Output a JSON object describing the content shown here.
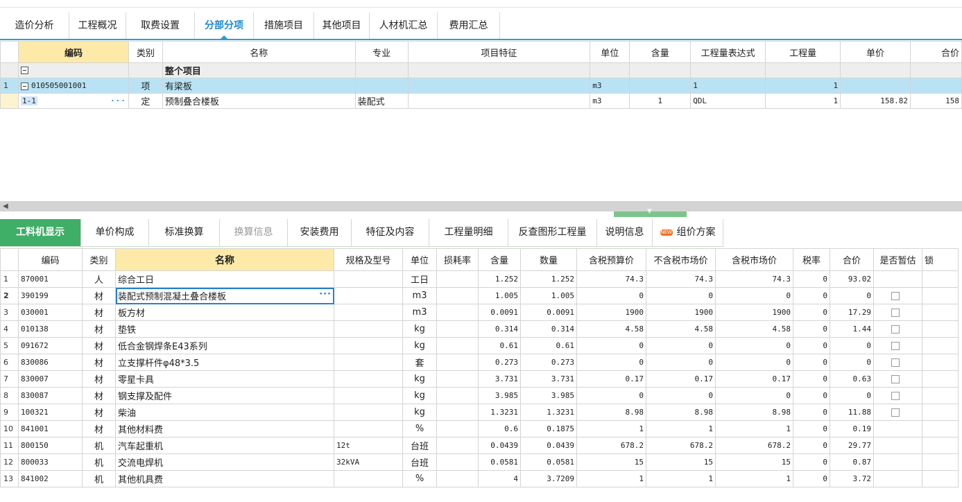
{
  "main_tabs": [
    {
      "label": "造价分析",
      "active": false
    },
    {
      "label": "工程概况",
      "active": false
    },
    {
      "label": "取费设置",
      "active": false
    },
    {
      "label": "分部分项",
      "active": true
    },
    {
      "label": "措施项目",
      "active": false
    },
    {
      "label": "其他项目",
      "active": false
    },
    {
      "label": "人材机汇总",
      "active": false
    },
    {
      "label": "费用汇总",
      "active": false
    }
  ],
  "top_table": {
    "headers": {
      "code": "编码",
      "type": "类别",
      "name": "名称",
      "spec": "专业",
      "feature": "项目特征",
      "unit": "单位",
      "qty_ratio": "含量",
      "expr": "工程量表达式",
      "quantity": "工程量",
      "price": "单价",
      "total": "合价"
    },
    "group_row": {
      "name": "整个项目"
    },
    "item_row": {
      "num": "1",
      "code": "010505001001",
      "type": "项",
      "name": "有梁板",
      "unit": "m3",
      "expr": "1",
      "quantity": "1"
    },
    "sub_row": {
      "code": "1-1",
      "ellipsis": "···",
      "type": "定",
      "name": "预制叠合楼板",
      "spec": "装配式",
      "unit": "m3",
      "qty_ratio": "1",
      "expr": "QDL",
      "quantity": "1",
      "price": "158.82",
      "total": "158"
    }
  },
  "lower_tabs": [
    {
      "label": "工料机显示",
      "state": "active"
    },
    {
      "label": "单价构成",
      "state": "normal"
    },
    {
      "label": "标准换算",
      "state": "normal"
    },
    {
      "label": "换算信息",
      "state": "disabled"
    },
    {
      "label": "安装费用",
      "state": "normal"
    },
    {
      "label": "特征及内容",
      "state": "normal"
    },
    {
      "label": "工程量明细",
      "state": "normal"
    },
    {
      "label": "反查图形工程量",
      "state": "normal"
    },
    {
      "label": "说明信息",
      "state": "normal"
    },
    {
      "label": "组价方案",
      "state": "normal",
      "badge": "NEW"
    }
  ],
  "bottom_table": {
    "headers": {
      "code": "编码",
      "type": "类别",
      "name": "名称",
      "spec": "规格及型号",
      "unit": "单位",
      "loss": "损耗率",
      "ratio": "含量",
      "qty": "数量",
      "tax_budget": "含税预算价",
      "notax_market": "不含税市场价",
      "tax_market": "含税市场价",
      "taxrate": "税率",
      "total": "合价",
      "provisional": "是否暂估",
      "lock": "锁"
    },
    "rows": [
      {
        "n": "1",
        "code": "870001",
        "type": "人",
        "name": "综合工日",
        "spec": "",
        "unit": "工日",
        "ratio": "1.252",
        "qty": "1.252",
        "tax_budget": "74.3",
        "notax_market": "74.3",
        "tax_market": "74.3",
        "taxrate": "0",
        "total": "93.02",
        "cb": false
      },
      {
        "n": "2",
        "code": "390199",
        "type": "材",
        "name": "装配式预制混凝土叠合楼板",
        "spec": "",
        "unit": "m3",
        "ratio": "1.005",
        "qty": "1.005",
        "tax_budget": "0",
        "notax_market": "0",
        "tax_market": "0",
        "taxrate": "0",
        "total": "0",
        "cb": true
      },
      {
        "n": "3",
        "code": "030001",
        "type": "材",
        "name": "板方材",
        "spec": "",
        "unit": "m3",
        "ratio": "0.0091",
        "qty": "0.0091",
        "tax_budget": "1900",
        "notax_market": "1900",
        "tax_market": "1900",
        "taxrate": "0",
        "total": "17.29",
        "cb": true
      },
      {
        "n": "4",
        "code": "010138",
        "type": "材",
        "name": "垫铁",
        "spec": "",
        "unit": "kg",
        "ratio": "0.314",
        "qty": "0.314",
        "tax_budget": "4.58",
        "notax_market": "4.58",
        "tax_market": "4.58",
        "taxrate": "0",
        "total": "1.44",
        "cb": true
      },
      {
        "n": "5",
        "code": "091672",
        "type": "材",
        "name": "低合金钢焊条E43系列",
        "spec": "",
        "unit": "kg",
        "ratio": "0.61",
        "qty": "0.61",
        "tax_budget": "0",
        "notax_market": "0",
        "tax_market": "0",
        "taxrate": "0",
        "total": "0",
        "cb": true
      },
      {
        "n": "6",
        "code": "830086",
        "type": "材",
        "name": "立支撑杆件φ48*3.5",
        "spec": "",
        "unit": "套",
        "ratio": "0.273",
        "qty": "0.273",
        "tax_budget": "0",
        "notax_market": "0",
        "tax_market": "0",
        "taxrate": "0",
        "total": "0",
        "cb": true
      },
      {
        "n": "7",
        "code": "830007",
        "type": "材",
        "name": "零星卡具",
        "spec": "",
        "unit": "kg",
        "ratio": "3.731",
        "qty": "3.731",
        "tax_budget": "0.17",
        "notax_market": "0.17",
        "tax_market": "0.17",
        "taxrate": "0",
        "total": "0.63",
        "cb": true
      },
      {
        "n": "8",
        "code": "830087",
        "type": "材",
        "name": "钢支撑及配件",
        "spec": "",
        "unit": "kg",
        "ratio": "3.985",
        "qty": "3.985",
        "tax_budget": "0",
        "notax_market": "0",
        "tax_market": "0",
        "taxrate": "0",
        "total": "0",
        "cb": true
      },
      {
        "n": "9",
        "code": "100321",
        "type": "材",
        "name": "柴油",
        "spec": "",
        "unit": "kg",
        "ratio": "1.3231",
        "qty": "1.3231",
        "tax_budget": "8.98",
        "notax_market": "8.98",
        "tax_market": "8.98",
        "taxrate": "0",
        "total": "11.88",
        "cb": true
      },
      {
        "n": "10",
        "code": "841001",
        "type": "材",
        "name": "其他材料费",
        "spec": "",
        "unit": "%",
        "ratio": "0.6",
        "qty": "0.1875",
        "tax_budget": "1",
        "notax_market": "1",
        "tax_market": "1",
        "taxrate": "0",
        "total": "0.19",
        "cb": false
      },
      {
        "n": "11",
        "code": "800150",
        "type": "机",
        "name": "汽车起重机",
        "spec": "12t",
        "unit": "台班",
        "ratio": "0.0439",
        "qty": "0.0439",
        "tax_budget": "678.2",
        "notax_market": "678.2",
        "tax_market": "678.2",
        "taxrate": "0",
        "total": "29.77",
        "cb": false
      },
      {
        "n": "12",
        "code": "800033",
        "type": "机",
        "name": "交流电焊机",
        "spec": "32kVA",
        "unit": "台班",
        "ratio": "0.0581",
        "qty": "0.0581",
        "tax_budget": "15",
        "notax_market": "15",
        "tax_market": "15",
        "taxrate": "0",
        "total": "0.87",
        "cb": false
      },
      {
        "n": "13",
        "code": "841002",
        "type": "机",
        "name": "其他机具费",
        "spec": "",
        "unit": "%",
        "ratio": "4",
        "qty": "3.7209",
        "tax_budget": "1",
        "notax_market": "1",
        "tax_market": "1",
        "taxrate": "0",
        "total": "3.72",
        "cb": false
      }
    ],
    "ellipsis": "···"
  },
  "colors": {
    "accent": "#2a9bd9",
    "active_tab_bg": "#3fae67",
    "header_highlight": "#fde9a8",
    "item_row": "#b9e3f5"
  }
}
